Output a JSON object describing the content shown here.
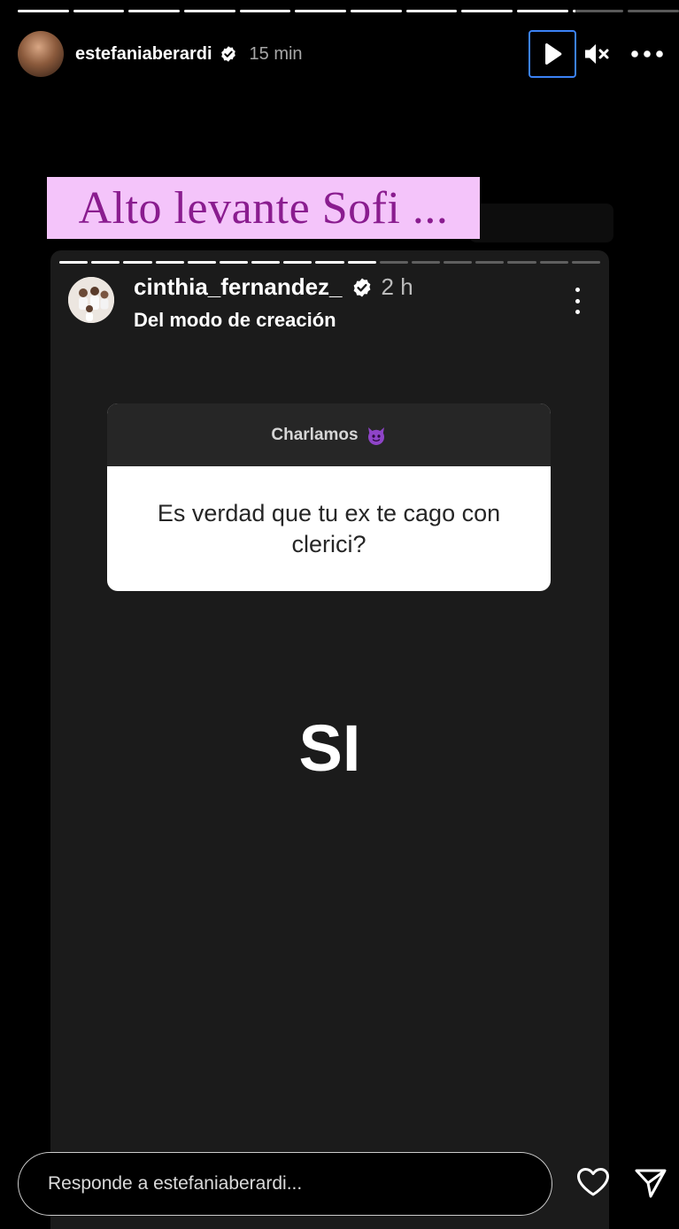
{
  "story": {
    "progress_segments": [
      1,
      1,
      1,
      1,
      1,
      1,
      1,
      1,
      1,
      1,
      0.05,
      0
    ],
    "username": "estefaniaberardi",
    "verified": true,
    "time": "15 min"
  },
  "caption": "Alto levante Sofi ...",
  "embedded_story": {
    "progress_segments": [
      1,
      1,
      1,
      1,
      1,
      1,
      1,
      1,
      1,
      1,
      0,
      0,
      0,
      0,
      0,
      0,
      0
    ],
    "username": "cinthia_fernandez_",
    "verified": true,
    "time": "2 h",
    "subtitle": "Del modo de creación",
    "question_header": "Charlamos",
    "question_icon": "devil-emoji-icon",
    "question_text": "Es verdad que tu ex te cago con clerici?",
    "answer": "SI"
  },
  "reply": {
    "placeholder": "Responde a estefaniaberardi..."
  },
  "icons": {
    "play": "play-icon",
    "mute": "speaker-muted-icon",
    "more": "more-horizontal-icon",
    "like": "heart-icon",
    "share": "send-icon"
  },
  "colors": {
    "caption_background": "#f4c4fa",
    "caption_text": "#8a1c8f",
    "focus_outline": "#3b82f6"
  }
}
